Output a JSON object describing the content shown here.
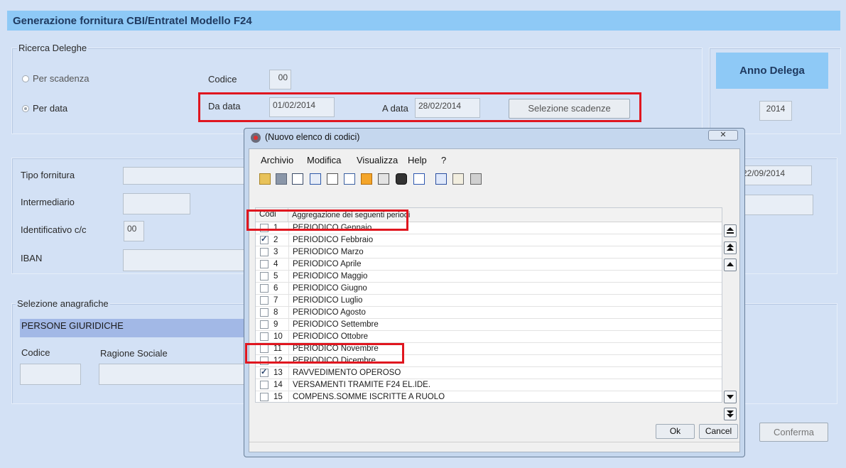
{
  "window": {
    "title": "Generazione fornitura CBI/Entratel Modello F24"
  },
  "ricerca": {
    "title": "Ricerca Deleghe",
    "per_scadenza": "Per scadenza",
    "per_data": "Per data",
    "codice_label": "Codice",
    "codice_value": "00",
    "da_data_label": "Da data",
    "da_data_value": "01/02/2014",
    "a_data_label": "A data",
    "a_data_value": "28/02/2014",
    "selezione_button": "Selezione scadenze"
  },
  "anno": {
    "title": "Anno Delega",
    "value": "2014"
  },
  "fornitura": {
    "tipo_label": "Tipo fornitura",
    "intermediario_label": "Intermediario",
    "identificativo_label": "Identificativo c/c",
    "identificativo_value": "00",
    "iban_label": "IBAN",
    "date_value": "22/09/2014"
  },
  "anagrafiche": {
    "title": "Selezione anagrafiche",
    "banner": "PERSONE GIURIDICHE",
    "codice_label": "Codice",
    "ragione_label": "Ragione Sociale"
  },
  "conferma_button": "Conferma",
  "dialog": {
    "title": "(Nuovo elenco di codici)",
    "menu": [
      "Archivio",
      "Modifica",
      "Visualizza",
      "Help",
      "?"
    ],
    "col_codi": "Codi",
    "col_desc": "Aggregazione dei seguenti periodi",
    "rows": [
      {
        "n": "1",
        "d": "PERIODICO Gennaio",
        "checked": false
      },
      {
        "n": "2",
        "d": "PERIODICO Febbraio",
        "checked": true
      },
      {
        "n": "3",
        "d": "PERIODICO Marzo",
        "checked": false
      },
      {
        "n": "4",
        "d": "PERIODICO Aprile",
        "checked": false
      },
      {
        "n": "5",
        "d": "PERIODICO Maggio",
        "checked": false
      },
      {
        "n": "6",
        "d": "PERIODICO Giugno",
        "checked": false
      },
      {
        "n": "7",
        "d": "PERIODICO Luglio",
        "checked": false
      },
      {
        "n": "8",
        "d": "PERIODICO Agosto",
        "checked": false
      },
      {
        "n": "9",
        "d": "PERIODICO Settembre",
        "checked": false
      },
      {
        "n": "10",
        "d": "PERIODICO Ottobre",
        "checked": false
      },
      {
        "n": "11",
        "d": "PERIODICO Novembre",
        "checked": false
      },
      {
        "n": "12",
        "d": "PERIODICO Dicembre",
        "checked": false
      },
      {
        "n": "13",
        "d": "RAVVEDIMENTO OPEROSO",
        "checked": true
      },
      {
        "n": "14",
        "d": "VERSAMENTI TRAMITE F24 EL.IDE.",
        "checked": false
      },
      {
        "n": "15",
        "d": "COMPENS.SOMME ISCRITTE A RUOLO",
        "checked": false
      }
    ],
    "ok": "Ok",
    "cancel": "Cancel"
  }
}
